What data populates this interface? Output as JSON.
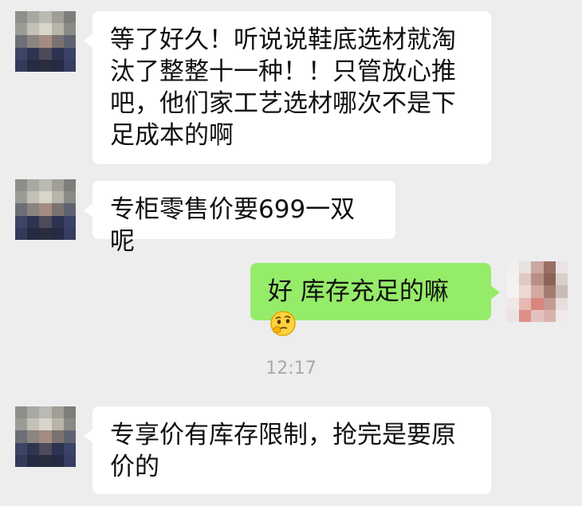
{
  "colors": {
    "background": "#ededed",
    "incoming_bubble": "#ffffff",
    "outgoing_bubble": "#95ec69",
    "timestamp": "#a9a9a9"
  },
  "messages": [
    {
      "direction": "in",
      "avatar": "pixelated-avatar",
      "text": "等了好久！听说说鞋底选材就淘汰了整整十一种！！只管放心推吧，他们家工艺选材哪次不是下足成本的啊"
    },
    {
      "direction": "in",
      "avatar": "pixelated-avatar",
      "text": "专柜零售价要699一双呢"
    },
    {
      "direction": "out",
      "avatar": "pixelated-avatar",
      "text": "好 库存充足的嘛",
      "emoji": "thinking-face-emoji"
    },
    {
      "direction": "in",
      "avatar": "pixelated-avatar",
      "text": "专享价有库存限制，抢完是要原价的"
    }
  ],
  "timestamp": "12:17"
}
